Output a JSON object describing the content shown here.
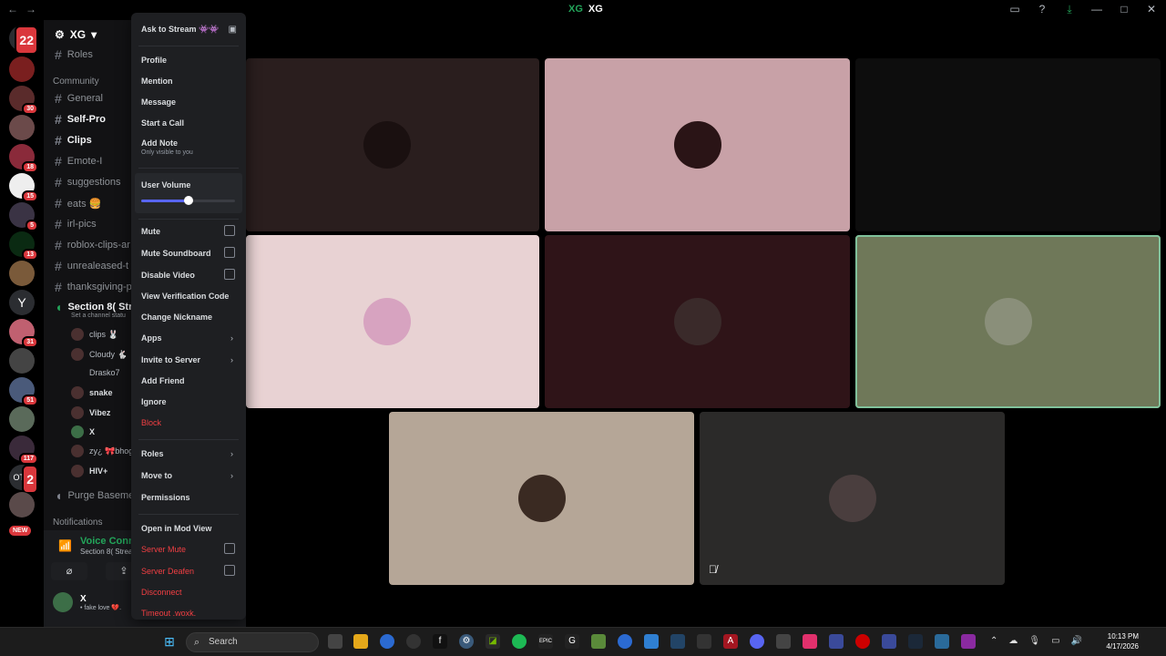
{
  "titlebar": {
    "back": "←",
    "forward": "→",
    "server_logo": "XG",
    "title": "XG",
    "icons": [
      "inbox-icon",
      "help-icon",
      "download-icon"
    ],
    "window": [
      "—",
      "□",
      "✕"
    ]
  },
  "guilds": {
    "dm_badge": "22",
    "badges": [
      "",
      "30",
      "",
      "18",
      "15",
      "5",
      "13",
      "",
      "",
      "31",
      "",
      "51",
      "",
      "117",
      "2",
      "13 NEW"
    ],
    "new_label": "NEW"
  },
  "sidebar": {
    "server_name": "XG",
    "roles": "Roles",
    "category": "Community",
    "channels": [
      "General",
      "Self-Pro",
      "Clips",
      "Emote-I",
      "suggestions",
      "eats 🍔",
      "irl-pics",
      "roblox-clips-ar",
      "unrealeased-t",
      "thanksgiving-p"
    ],
    "voice_channel": "Section 8( Stre",
    "voice_status": "Set a channel statu",
    "members": [
      "clips 🐰",
      "Cloudy 🐇",
      "Drasko7",
      "snake",
      "Vibez",
      "X",
      "zy¿ 🎀bhog",
      "HIV+"
    ],
    "purge": "Purge Basemen",
    "notifications": "Notifications",
    "new_pill": "13 NEW",
    "voice_connected": "Voice Connected",
    "voice_connected_sub": "Section 8( Streaming NO TOS)",
    "user_name": "X",
    "user_status": "• fake love 💔."
  },
  "menu": {
    "ask_to_stream": "Ask to Stream 👾👾",
    "profile": "Profile",
    "mention": "Mention",
    "message": "Message",
    "start_call": "Start a Call",
    "add_note": "Add Note",
    "add_note_sub": "Only visible to you",
    "user_volume": "User Volume",
    "user_volume_level": 0.5,
    "mute": "Mute",
    "mute_soundboard": "Mute Soundboard",
    "disable_video": "Disable Video",
    "view_verification": "View Verification Code",
    "change_nickname": "Change Nickname",
    "apps": "Apps",
    "invite": "Invite to Server",
    "add_friend": "Add Friend",
    "ignore": "Ignore",
    "block": "Block",
    "roles": "Roles",
    "move_to": "Move to",
    "permissions": "Permissions",
    "mod_view": "Open in Mod View",
    "server_mute": "Server Mute",
    "server_deafen": "Server Deafen",
    "disconnect": "Disconnect",
    "timeout": "Timeout .woxk."
  },
  "colors": {
    "accent": "#5865f2",
    "danger": "#f23f43",
    "online": "#23a55a"
  },
  "taskbar": {
    "search": "Search",
    "time": "10:13 PM",
    "date": "4/17/2026"
  }
}
